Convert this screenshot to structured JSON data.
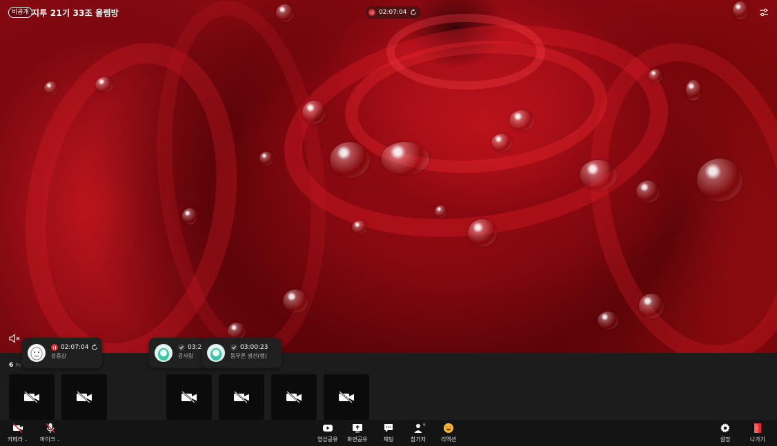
{
  "room": {
    "privacy_badge": "비공개",
    "title": "지투 21기 33조 올렘방"
  },
  "session_timer": "02:07:04",
  "participants": {
    "count": "6",
    "count_suffix": "Pe",
    "tiles": 6
  },
  "timer_cards": [
    {
      "time": "02:07:04",
      "name": "강중강",
      "state": "paused"
    },
    {
      "time": "03:21",
      "name": "감사링",
      "state": "done"
    },
    {
      "time": "03:00:23",
      "name": "동무른 생선(랭)",
      "state": "done"
    }
  ],
  "toolbar": {
    "camera": "카메라",
    "mic": "마이크",
    "video_share": "영상공유",
    "screen_share": "화면공유",
    "chat": "채팅",
    "participants": "참가자",
    "participants_count": "6",
    "reaction": "리액션",
    "settings": "설정",
    "leave": "나가기"
  },
  "colors": {
    "record_red": "#e5282e",
    "strip_bg": "#1c1c1c",
    "tile_bg": "#0b0b0b",
    "toolbar_bg": "#141414"
  }
}
